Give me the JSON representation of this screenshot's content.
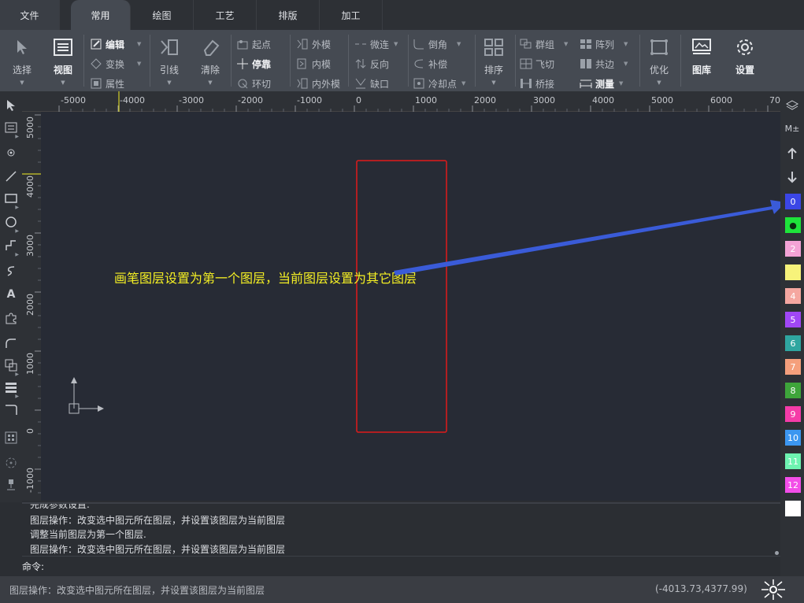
{
  "menu": {
    "tabs": [
      "文件",
      "常用",
      "绘图",
      "工艺",
      "排版",
      "加工"
    ],
    "active": "常用"
  },
  "ribbon": {
    "select": "选择",
    "view": "视图",
    "edit": "编辑",
    "transform": "变换",
    "property": "属性",
    "leadline": "引线",
    "clear": "清除",
    "start_point": "起点",
    "dock": "停靠",
    "ring_cut": "环切",
    "outer_mold": "外模",
    "inner_mold": "内模",
    "inner_outer_mold": "内外模",
    "micro_link": "微连",
    "reverse": "反向",
    "gap": "缺口",
    "chamfer": "倒角",
    "compensate": "补偿",
    "cooling_point": "冷却点",
    "sort": "排序",
    "group": "群组",
    "fly_cut": "飞切",
    "bridge": "桥接",
    "array": "阵列",
    "common_edge": "共边",
    "measure": "测量",
    "optimize": "优化",
    "library": "图库",
    "settings": "设置"
  },
  "ruler": {
    "h_labels": [
      "-5000",
      "-4000",
      "-3000",
      "-2000",
      "-1000",
      "0",
      "1000",
      "2000",
      "3000",
      "4000",
      "5000",
      "6000",
      "70"
    ],
    "v_labels": [
      "5000",
      "4000",
      "3000",
      "2000",
      "1000",
      "0",
      "-1000"
    ]
  },
  "canvas": {
    "annotation": "画笔图层设置为第一个图层，当前图层设置为其它图层"
  },
  "layers": {
    "icon_top": "M±",
    "items": [
      {
        "label": "0",
        "color": "#3b46e6"
      },
      {
        "label": "●",
        "color": "#1ee43a"
      },
      {
        "label": "2",
        "color": "#f4a3d5"
      },
      {
        "label": "",
        "color": "#f7f37a"
      },
      {
        "label": "4",
        "color": "#f5a7a0"
      },
      {
        "label": "5",
        "color": "#a047f5"
      },
      {
        "label": "6",
        "color": "#2fa6a0"
      },
      {
        "label": "7",
        "color": "#f5a07c"
      },
      {
        "label": "8",
        "color": "#3ea53a"
      },
      {
        "label": "9",
        "color": "#f53ca8"
      },
      {
        "label": "10",
        "color": "#3c97f0"
      },
      {
        "label": "11",
        "color": "#6ef3b0"
      },
      {
        "label": "12",
        "color": "#f34ee8"
      },
      {
        "label": "",
        "color": "#ffffff"
      }
    ]
  },
  "command": {
    "log": [
      "完成参数设置.",
      "图层操作：改变选中图元所在图层，并设置该图层为当前图层",
      "调整当前图层为第一个图层.",
      "图层操作：改变选中图元所在图层，并设置该图层为当前图层"
    ],
    "label": "命令:",
    "input_value": ""
  },
  "status": {
    "text": "图层操作：改变选中图元所在图层，并设置该图层为当前图层",
    "coords": "(-4013.73,4377.99)"
  },
  "colors": {
    "canvas_bg": "#272b35",
    "annotation": "#f4ef24",
    "rect_stroke": "#e01b1b",
    "arrow": "#3a5bd8"
  }
}
